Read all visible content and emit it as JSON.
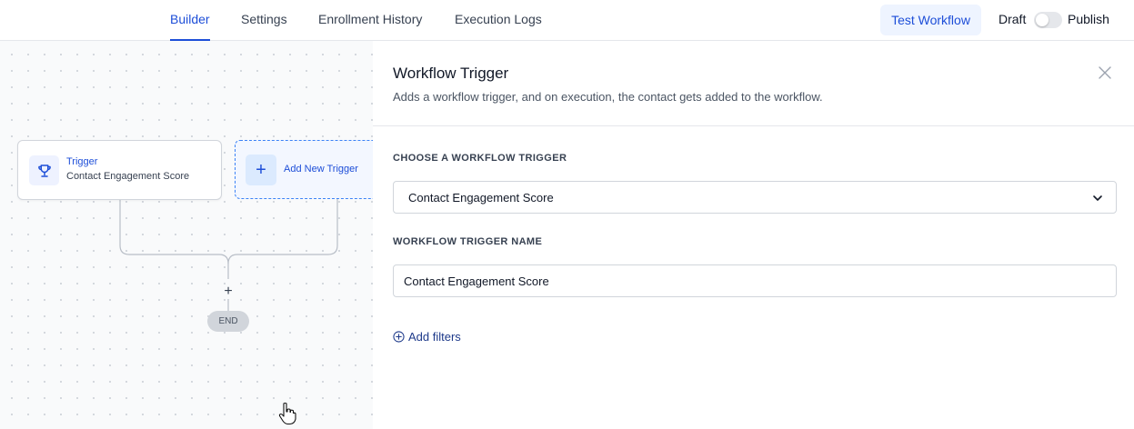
{
  "topbar": {
    "tabs": [
      {
        "label": "Builder",
        "active": true
      },
      {
        "label": "Settings",
        "active": false
      },
      {
        "label": "Enrollment History",
        "active": false
      },
      {
        "label": "Execution Logs",
        "active": false
      }
    ],
    "test_workflow_label": "Test Workflow",
    "draft_label": "Draft",
    "publish_label": "Publish",
    "publish_toggle_on": false
  },
  "canvas": {
    "trigger_card": {
      "title": "Trigger",
      "subtitle": "Contact Engagement Score",
      "icon": "trophy-icon"
    },
    "add_trigger": {
      "label": "Add New Trigger",
      "icon": "plus-icon"
    },
    "add_step_symbol": "+",
    "end_label": "END"
  },
  "panel": {
    "title": "Workflow Trigger",
    "description": "Adds a workflow trigger, and on execution, the contact gets added to the workflow.",
    "choose_trigger_label": "CHOOSE A WORKFLOW TRIGGER",
    "selected_trigger": "Contact Engagement Score",
    "trigger_name_label": "WORKFLOW TRIGGER NAME",
    "trigger_name_value": "Contact Engagement Score",
    "add_filters_label": "Add filters"
  },
  "colors": {
    "accent": "#1d4ed8",
    "accent_light": "#eef4ff",
    "canvas_bg": "#f9fafb",
    "border": "#d1d5db"
  }
}
